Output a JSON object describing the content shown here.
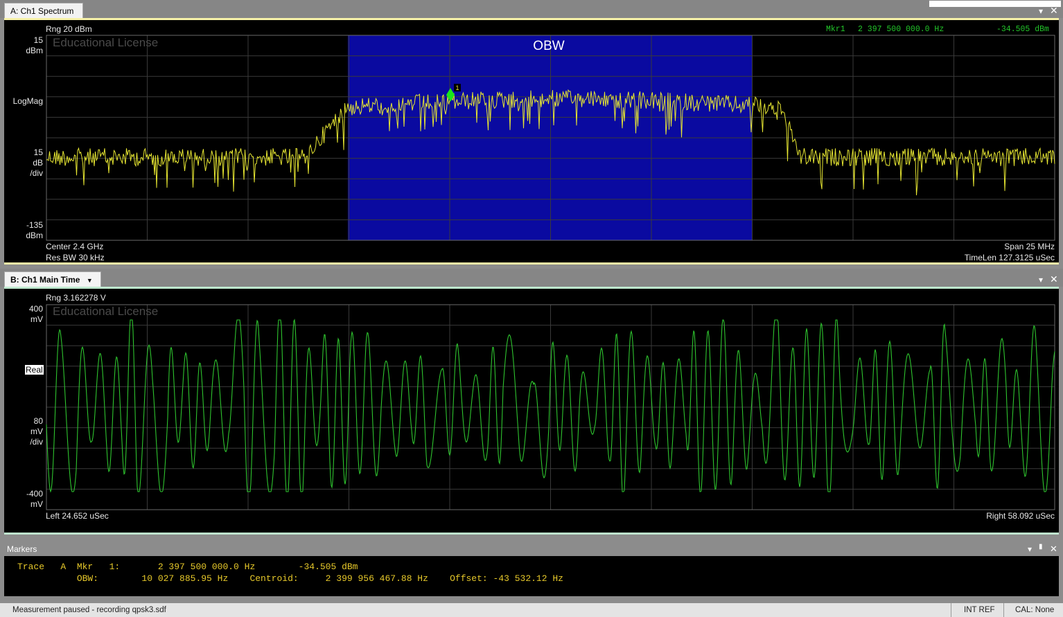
{
  "window": {
    "corner_box": ""
  },
  "trace_a": {
    "tab_label": "A: Ch1 Spectrum",
    "range_label": "Rng 20 dBm",
    "watermark": "Educational License",
    "marker_header": {
      "name": "Mkr1",
      "freq": "2 397 500 000.0 Hz",
      "value": "-34.505 dBm"
    },
    "y_top": [
      "15",
      "dBm"
    ],
    "y_format": "LogMag",
    "y_scale": [
      "15",
      "dB",
      "/div"
    ],
    "y_bottom": [
      "-135",
      "dBm"
    ],
    "band_label": "OBW",
    "marker_id": "1",
    "footer_left": [
      "Center 2.4 GHz",
      "Res BW 30 kHz"
    ],
    "footer_right": [
      "Span 25 MHz",
      "TimeLen 127.3125 uSec"
    ],
    "colors": {
      "trace": "#e6e632",
      "band": "#0a0aa0",
      "marker": "#19e619",
      "grid": "#3a3a3a"
    }
  },
  "trace_b": {
    "tab_label": "B: Ch1 Main Time",
    "range_label": "Rng 3.162278  V",
    "watermark": "Educational License",
    "y_top": [
      "400",
      "mV"
    ],
    "y_format": "Real",
    "y_scale": [
      "80",
      "mV",
      "/div"
    ],
    "y_bottom": [
      "-400",
      "mV"
    ],
    "footer_left": "Left 24.652 uSec",
    "footer_right": "Right 58.092 uSec",
    "colors": {
      "trace": "#2ec42e",
      "grid": "#3a3a3a"
    }
  },
  "markers_panel": {
    "title": "Markers",
    "line1": "Trace   A  Mkr   1:       2 397 500 000.0 Hz        -34.505 dBm",
    "line2": "           OBW:        10 027 885.95 Hz    Centroid:     2 399 956 467.88 Hz    Offset: -43 532.12 Hz"
  },
  "status_bar": {
    "message": "Measurement paused - recording qpsk3.sdf",
    "int_ref": "INT REF",
    "cal": "CAL: None"
  }
}
